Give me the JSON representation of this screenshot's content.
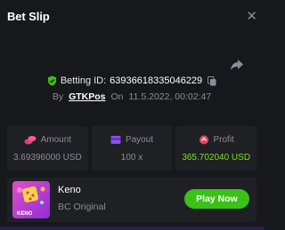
{
  "header": {
    "title": "Bet Slip",
    "close_icon": "close-icon"
  },
  "bet": {
    "id_label": "Betting ID:",
    "id_value": "63936618335046229",
    "by_label": "By",
    "user": "GTKPos",
    "on_label": "On",
    "datetime": "11.5.2022, 00:02:47"
  },
  "stats": {
    "amount": {
      "label": "Amount",
      "value": "3.69396000 USD"
    },
    "payout": {
      "label": "Payout",
      "value": "100 x"
    },
    "profit": {
      "label": "Profit",
      "value": "365.702040 USD"
    }
  },
  "game": {
    "name": "Keno",
    "provider": "BC Original",
    "thumb_text": "KENO",
    "play_label": "Play Now"
  },
  "colors": {
    "background": "#17181b",
    "card": "#1e2024",
    "accent_green": "#3bc117",
    "profit_green": "#7ee022",
    "muted": "#8a8d93"
  }
}
